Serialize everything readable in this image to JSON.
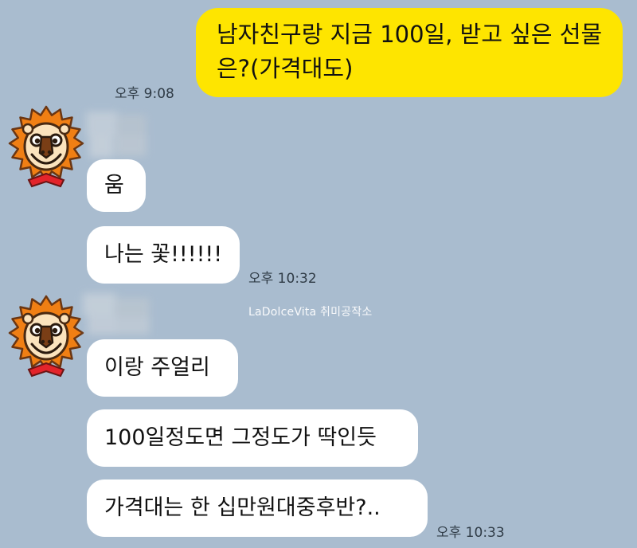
{
  "messages": {
    "sent": {
      "text": "남자친구랑 지금 100일, 받고 싶은 선물은?(가격대도)",
      "time": "오후 9:08"
    },
    "group1": {
      "bubbles": [
        "움",
        "나는 꽃!!!!!!"
      ],
      "time": "오후 10:32"
    },
    "group2": {
      "bubbles": [
        "이랑 주얼리",
        "100일정도면 그정도가 딱인듯",
        "가격대는 한 십만원대중후반?.."
      ],
      "time": "오후 10:33"
    }
  },
  "watermark": "LaDolceVita 취미공작소",
  "avatar": {
    "icon": "lion-avatar-icon"
  },
  "colors": {
    "background": "#a9bccf",
    "sent_bubble": "#fee500",
    "received_bubble": "#ffffff"
  }
}
